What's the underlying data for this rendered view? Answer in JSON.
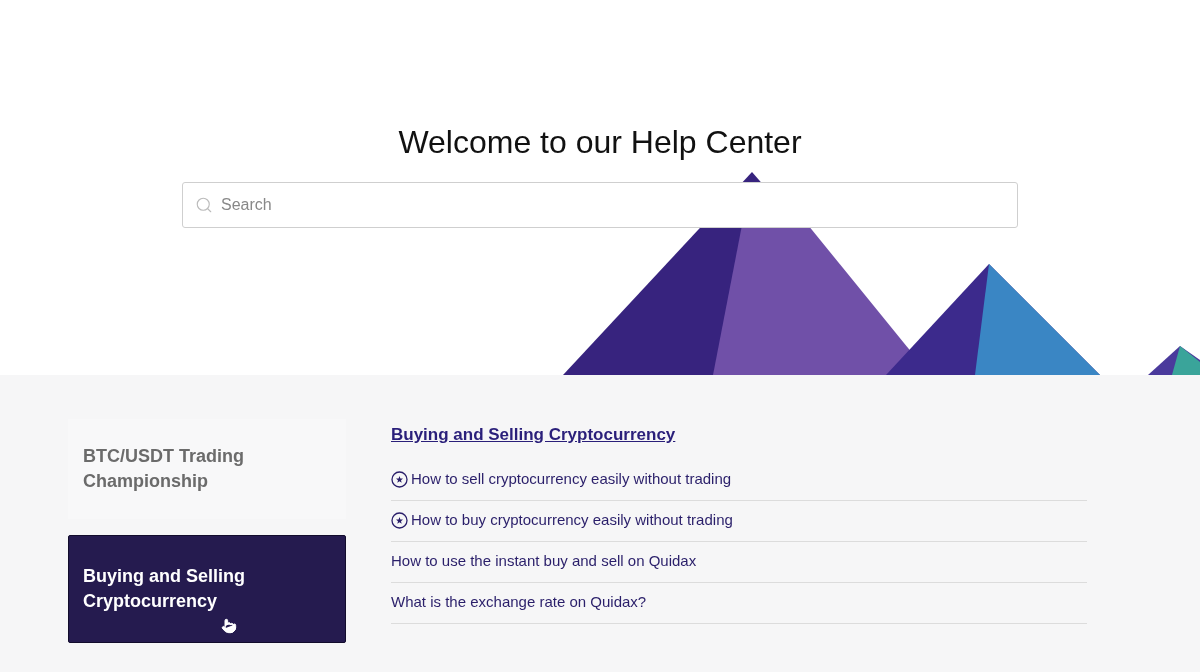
{
  "hero": {
    "title": "Welcome to our Help Center",
    "search": {
      "placeholder": "Search"
    }
  },
  "categories": [
    {
      "label": "BTC/USDT Trading Championship",
      "selected": false
    },
    {
      "label": "Buying and Selling Cryptocurrency",
      "selected": true
    }
  ],
  "section": {
    "title": "Buying and Selling Cryptocurrency",
    "articles": [
      {
        "title": "How to sell cryptocurrency easily without trading",
        "promoted": true
      },
      {
        "title": "How to buy cryptocurrency easily without trading",
        "promoted": true
      },
      {
        "title": "How to use the instant buy and sell on Quidax",
        "promoted": false
      },
      {
        "title": "What is the exchange rate on Quidax?",
        "promoted": false
      }
    ]
  }
}
